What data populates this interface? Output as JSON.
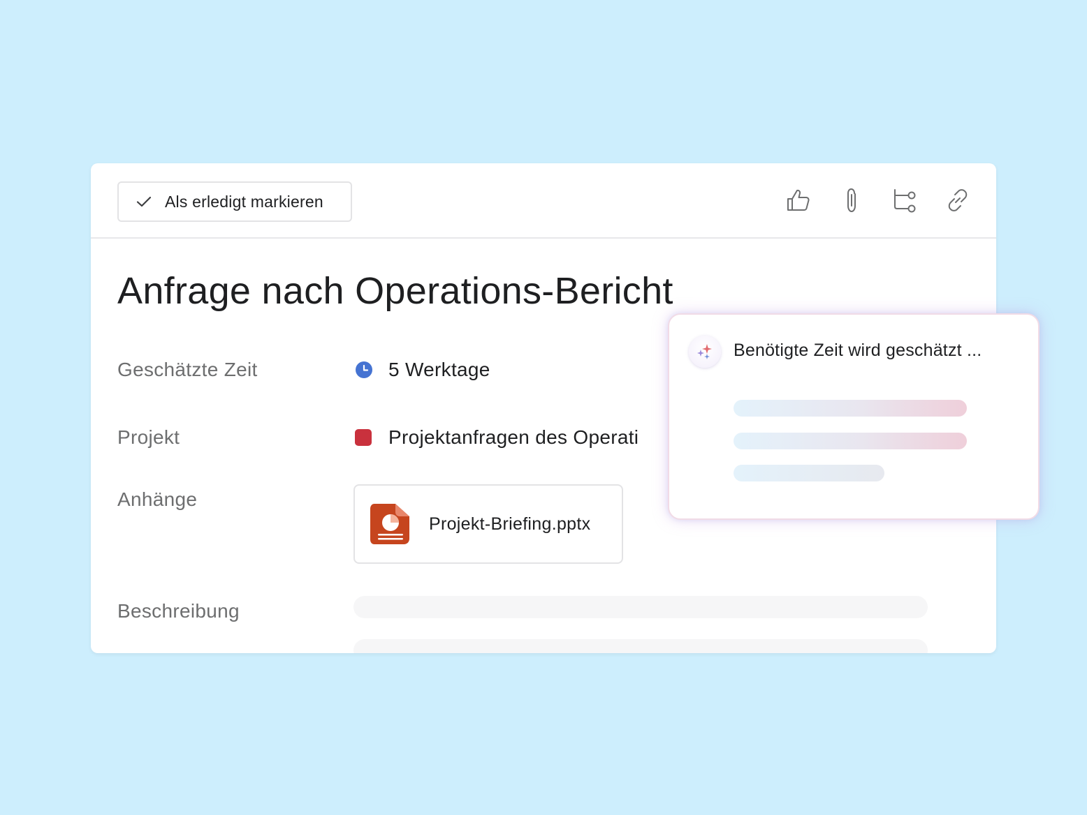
{
  "toolbar": {
    "mark_done_label": "Als erledigt markieren",
    "icons": [
      "thumbs-up-icon",
      "paperclip-icon",
      "subtask-icon",
      "link-icon"
    ]
  },
  "task": {
    "title": "Anfrage nach Operations-Bericht",
    "fields": {
      "estimated_time": {
        "label": "Geschätzte Zeit",
        "value": "5 Werktage",
        "icon": "clock-icon",
        "icon_color": "#4573d2"
      },
      "project": {
        "label": "Projekt",
        "value": "Projektanfragen des Operati",
        "color": "#c9313d"
      },
      "attachments": {
        "label": "Anhänge",
        "file_name": "Projekt-Briefing.pptx",
        "icon": "powerpoint-file-icon",
        "icon_color": "#c6451e"
      },
      "description": {
        "label": "Beschreibung"
      }
    }
  },
  "ai_popup": {
    "icon": "sparkle-icon",
    "status_text": "Benötigte Zeit wird geschätzt ..."
  },
  "colors": {
    "background": "#cdeefd",
    "card": "#ffffff",
    "label_gray": "#6d6e6f"
  }
}
